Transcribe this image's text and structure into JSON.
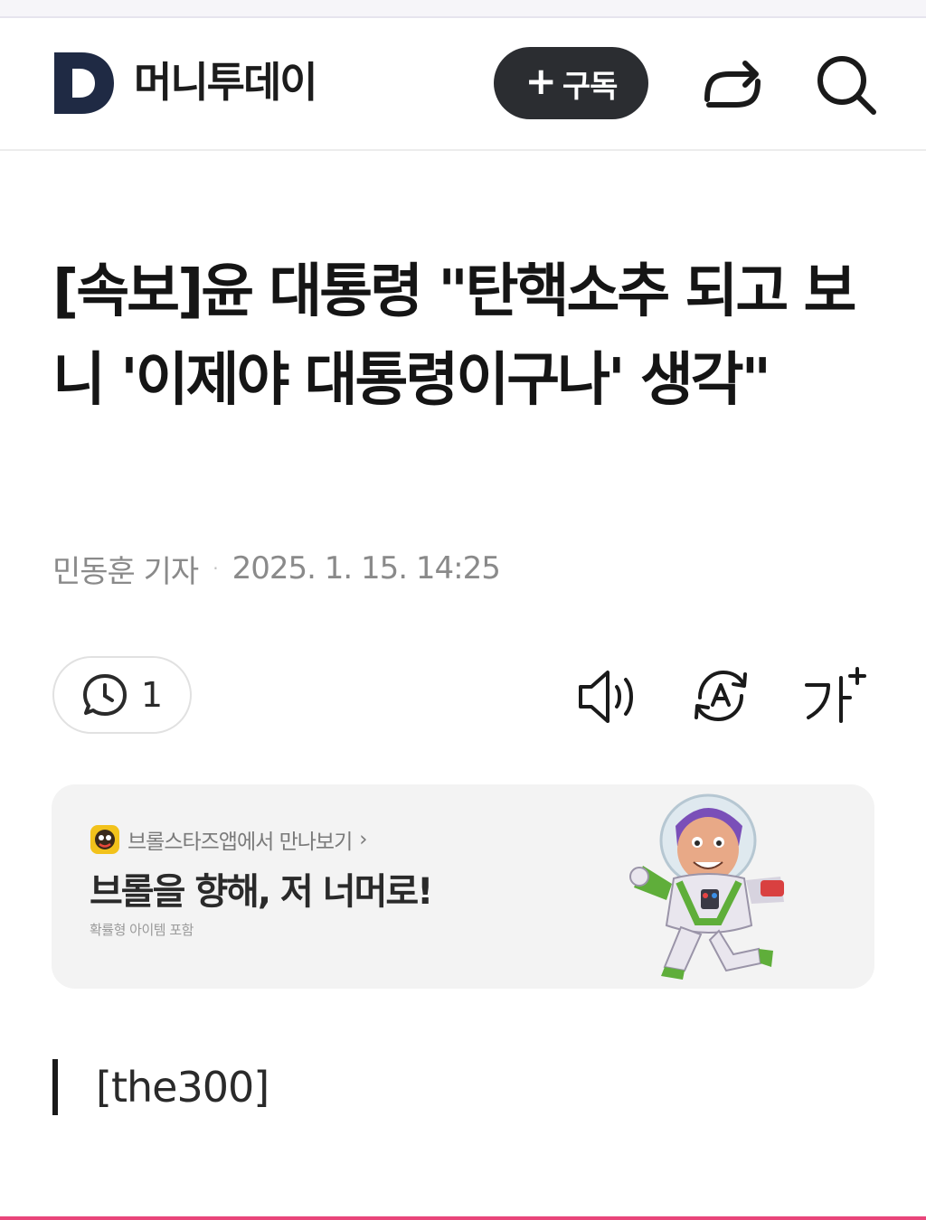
{
  "header": {
    "brand_name": "머니투데이",
    "subscribe_plus": "+",
    "subscribe_label": "구독"
  },
  "article": {
    "headline": "[속보]윤 대통령 \"탄핵소추 되고 보니 '이제야 대통령이구나' 생각\"",
    "author": "민동훈 기자",
    "separator": "·",
    "datetime": "2025. 1. 15. 14:25",
    "comment_count": "1",
    "section_tag": "[the300]"
  },
  "ad": {
    "source": "브롤스타즈앱에서 만나보기",
    "source_arrow": "›",
    "title": "브롤을 향해, 저 너머로!",
    "note": "확률형 아이템 포함"
  },
  "colors": {
    "brand_logo": "#1f2a44",
    "subscribe_bg": "#2b2d31",
    "ad_bg": "#f3f3f3",
    "byline_text": "#8a8a8a",
    "bottom_accent": "#e9457a"
  },
  "icons": {
    "logo": "brand-d-logo",
    "share": "share-icon",
    "search": "search-icon",
    "comment": "comment-clock-icon",
    "tts": "speaker-icon",
    "translate": "translate-icon",
    "fontsize": "font-size-icon"
  }
}
